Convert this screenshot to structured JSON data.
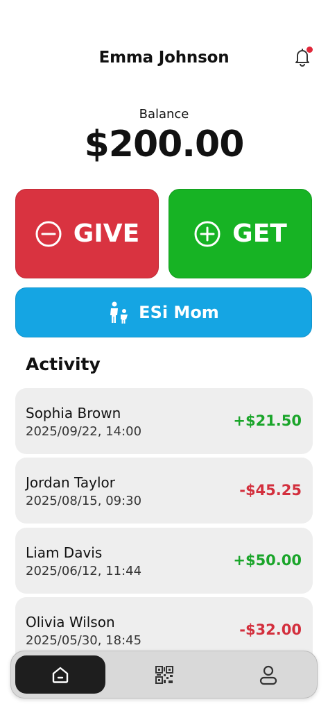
{
  "header": {
    "user_name": "Emma Johnson",
    "notification_icon": "bell-icon",
    "has_unread_notification": true
  },
  "balance": {
    "label": "Balance",
    "amount": "$200.00"
  },
  "actions": {
    "give": {
      "label": "GIVE",
      "icon": "minus-circle-icon",
      "color": "#d93340"
    },
    "get": {
      "label": "GET",
      "icon": "plus-circle-icon",
      "color": "#17b324"
    },
    "parent": {
      "label": "ESi Mom",
      "icon": "parent-child-icon",
      "color": "#15a5e3"
    }
  },
  "activity": {
    "title": "Activity",
    "items": [
      {
        "name": "Sophia Brown",
        "date": "2025/09/22, 14:00",
        "amount": "+$21.50",
        "type": "credit"
      },
      {
        "name": "Jordan Taylor",
        "date": "2025/08/15, 09:30",
        "amount": "-$45.25",
        "type": "debit"
      },
      {
        "name": "Liam Davis",
        "date": "2025/06/12, 11:44",
        "amount": "+$50.00",
        "type": "credit"
      },
      {
        "name": "Olivia Wilson",
        "date": "2025/05/30, 18:45",
        "amount": "-$32.00",
        "type": "debit"
      }
    ]
  },
  "colors": {
    "credit": "#1aa52a",
    "debit": "#d32f3d"
  },
  "bottom_nav": {
    "items": [
      {
        "icon": "home-icon",
        "active": true
      },
      {
        "icon": "qr-code-icon",
        "active": false
      },
      {
        "icon": "profile-icon",
        "active": false
      }
    ]
  }
}
